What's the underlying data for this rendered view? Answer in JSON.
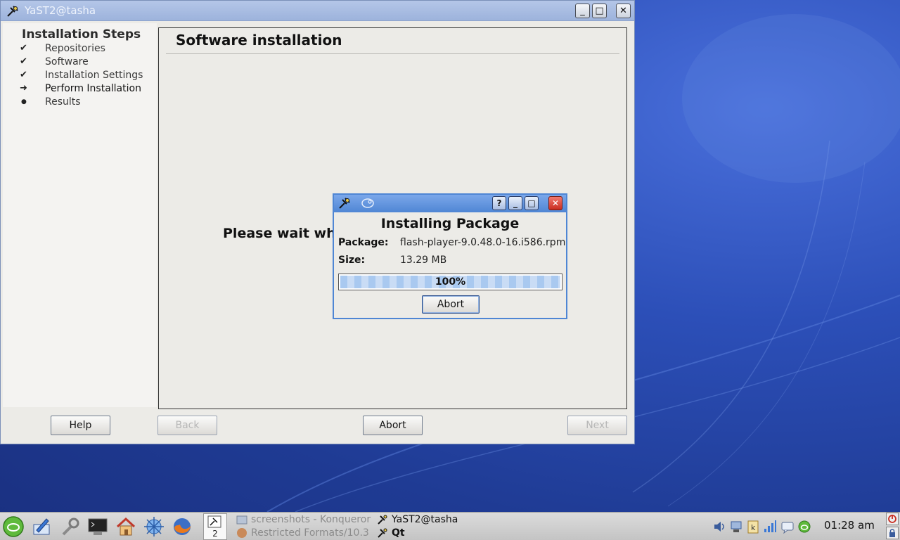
{
  "main_window": {
    "title": "YaST2@tasha",
    "controls": {
      "minimize": "_",
      "maximize": "□",
      "close": "✕"
    }
  },
  "sidebar": {
    "heading": "Installation Steps",
    "steps": [
      {
        "mark": "✔",
        "label": "Repositories",
        "state": "done"
      },
      {
        "mark": "✔",
        "label": "Software",
        "state": "done"
      },
      {
        "mark": "✔",
        "label": "Installation Settings",
        "state": "done"
      },
      {
        "mark": "➜",
        "label": "Perform Installation",
        "state": "current"
      },
      {
        "mark": "●",
        "label": "Results",
        "state": "pending"
      }
    ]
  },
  "content": {
    "title": "Software installation",
    "wait_text": "Please wait whil"
  },
  "buttons": {
    "help": "Help",
    "back": "Back",
    "abort": "Abort",
    "next": "Next"
  },
  "dialog": {
    "controls": {
      "help": "?",
      "minimize": "_",
      "maximize": "□",
      "close": "✕"
    },
    "heading": "Installing Package",
    "package_label": "Package:",
    "package_value": "flash-player-9.0.48.0-16.i586.rpm",
    "size_label": "Size:",
    "size_value": "13.29 MB",
    "progress_text": "100%",
    "progress_fraction": 1.0,
    "abort_label": "Abort"
  },
  "taskbar": {
    "launchers": [
      "opensuse-menu-icon",
      "kate-editor-icon",
      "yast-tools-icon",
      "terminal-icon",
      "home-folder-icon",
      "kde-network-icon",
      "firefox-icon"
    ],
    "pager_number": "2",
    "tasks": [
      {
        "label": "screenshots - Konqueror",
        "state": "inactive"
      },
      {
        "label": "Restricted Formats/10.3",
        "state": "inactive"
      },
      {
        "label": "YaST2@tasha",
        "state": "active"
      },
      {
        "label": "Qt",
        "state": "active"
      }
    ],
    "tray": [
      "volume-icon",
      "network-icon",
      "klipper-icon",
      "signal-bars-icon",
      "chat-icon",
      "updater-icon"
    ],
    "clock": "01:28 am"
  },
  "colors": {
    "desktop": "#2c4fb8",
    "window_bg": "#ecebe7",
    "dialog_border": "#4f86d4",
    "close_red": "#c92d20"
  }
}
